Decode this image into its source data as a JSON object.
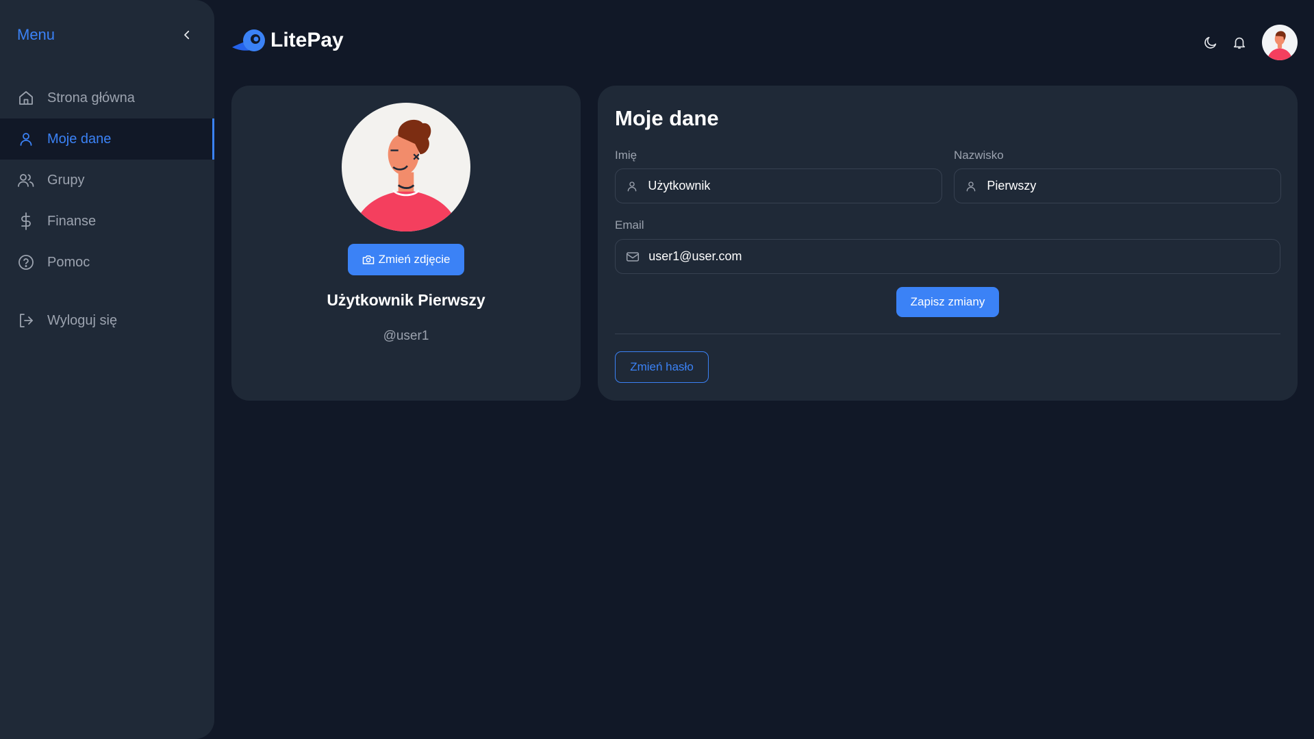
{
  "app": {
    "name": "LitePay"
  },
  "sidebar": {
    "title": "Menu",
    "items": [
      {
        "label": "Strona główna",
        "icon": "home-icon",
        "active": false
      },
      {
        "label": "Moje dane",
        "icon": "user-icon",
        "active": true
      },
      {
        "label": "Grupy",
        "icon": "users-icon",
        "active": false
      },
      {
        "label": "Finanse",
        "icon": "dollar-icon",
        "active": false
      },
      {
        "label": "Pomoc",
        "icon": "help-icon",
        "active": false
      }
    ],
    "logout_label": "Wyloguj się"
  },
  "profile": {
    "change_photo_label": "Zmień zdjęcie",
    "full_name": "Użytkownik Pierwszy",
    "handle": "@user1"
  },
  "form": {
    "title": "Moje dane",
    "first_name_label": "Imię",
    "first_name_value": "Użytkownik",
    "last_name_label": "Nazwisko",
    "last_name_value": "Pierwszy",
    "email_label": "Email",
    "email_value": "user1@user.com",
    "save_label": "Zapisz zmiany",
    "change_password_label": "Zmień hasło"
  },
  "colors": {
    "accent": "#3b82f6",
    "background": "#111827",
    "surface": "#1f2937",
    "avatar_shirt": "#f43f5e",
    "avatar_hair": "#7c2d12",
    "avatar_skin": "#f28c6b"
  }
}
